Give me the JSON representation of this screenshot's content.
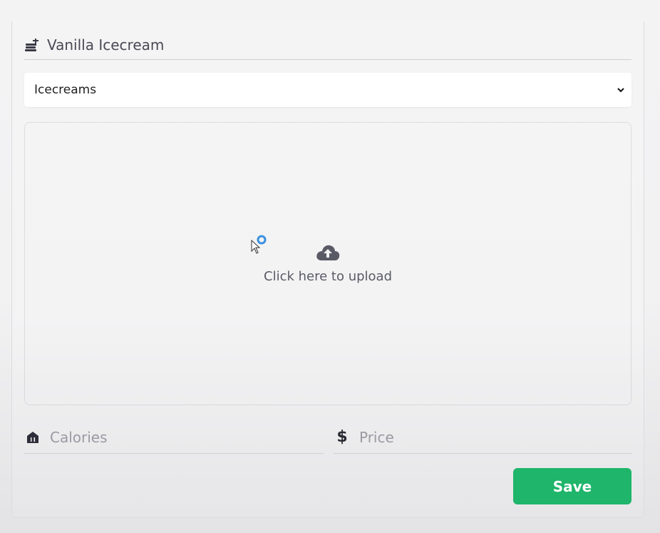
{
  "form": {
    "title_value": "Vanilla Icecream",
    "category": {
      "selected": "Icecreams"
    },
    "upload": {
      "label": "Click here to upload"
    },
    "calories": {
      "placeholder": "Calories"
    },
    "price": {
      "symbol": "$",
      "placeholder": "Price"
    },
    "save_label": "Save"
  },
  "icons": {
    "title": "food-tray-icon",
    "dropdown": "chevron-down-icon",
    "upload": "cloud-upload-icon",
    "calories": "restaurant-icon",
    "price": "dollar-icon",
    "cursor": "mouse-cursor-icon"
  },
  "colors": {
    "accent": "#1fb56a",
    "text": "#4a4a55",
    "cursor_ring": "#3b8fe0"
  }
}
